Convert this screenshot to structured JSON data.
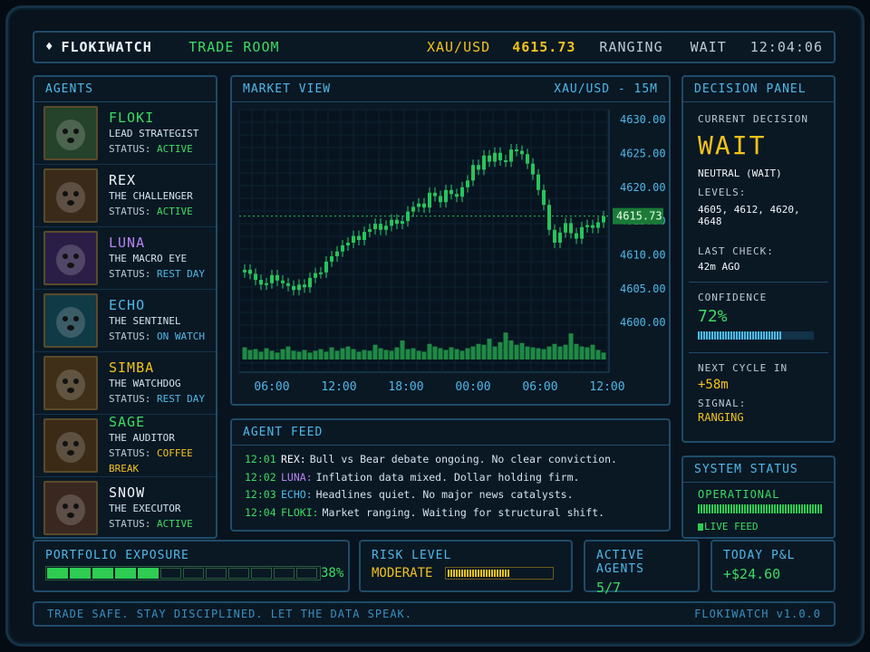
{
  "header": {
    "app": "FLOKIWATCH",
    "room": "TRADE ROOM",
    "symbol": "XAU/USD",
    "price": "4615.73",
    "state": "RANGING",
    "action": "WAIT",
    "clock": "12:04:06"
  },
  "agents": {
    "title": "AGENTS",
    "items": [
      {
        "name": "FLOKI",
        "role": "LEAD STRATEGIST",
        "status_label": "STATUS:",
        "status": "ACTIVE",
        "color": "#3ddc62",
        "status_color": "#3ddc62",
        "icon": "dog-avatar-icon",
        "bg": "#25422a"
      },
      {
        "name": "REX",
        "role": "THE CHALLENGER",
        "status_label": "STATUS:",
        "status": "ACTIVE",
        "color": "#eef6fb",
        "status_color": "#3ddc62",
        "icon": "dog-avatar-icon",
        "bg": "#3a2a1a"
      },
      {
        "name": "LUNA",
        "role": "THE MACRO EYE",
        "status_label": "STATUS:",
        "status": "REST DAY",
        "color": "#b784f0",
        "status_color": "#4fb8e8",
        "icon": "fox-avatar-icon",
        "bg": "#2a1e46"
      },
      {
        "name": "ECHO",
        "role": "THE SENTINEL",
        "status_label": "STATUS:",
        "status": "ON WATCH",
        "color": "#4fb8e8",
        "status_color": "#4fb8e8",
        "icon": "bat-avatar-icon",
        "bg": "#0f3a46"
      },
      {
        "name": "SIMBA",
        "role": "THE WATCHDOG",
        "status_label": "STATUS:",
        "status": "REST DAY",
        "color": "#f2c21b",
        "status_color": "#4fb8e8",
        "icon": "lion-avatar-icon",
        "bg": "#3f2f18"
      },
      {
        "name": "SAGE",
        "role": "THE AUDITOR",
        "status_label": "STATUS:",
        "status": "COFFEE BREAK",
        "color": "#3ddc62",
        "status_color": "#f2c21b",
        "icon": "owl-avatar-icon",
        "bg": "#3a2a16"
      },
      {
        "name": "SNOW",
        "role": "THE EXECUTOR",
        "status_label": "STATUS:",
        "status": "ACTIVE",
        "color": "#eef6fb",
        "status_color": "#3ddc62",
        "icon": "dog-avatar-icon",
        "bg": "#3a2820"
      }
    ]
  },
  "market": {
    "title": "MARKET VIEW",
    "pair": "XAU/USD - 15M"
  },
  "chart_data": {
    "type": "candlestick",
    "x_ticks": [
      "06:00",
      "12:00",
      "18:00",
      "00:00",
      "06:00",
      "12:00"
    ],
    "y_ticks": [
      "4630.00",
      "4625.00",
      "4620.00",
      "4615.00",
      "4610.00",
      "4605.00",
      "4600.00"
    ],
    "ylim": [
      4598,
      4631.5
    ],
    "last_price": "4615.73",
    "closes": [
      4607.8,
      4607.2,
      4606.3,
      4605.6,
      4605.8,
      4607.0,
      4606.2,
      4605.8,
      4605.4,
      4604.8,
      4605.6,
      4605.2,
      4606.6,
      4607.3,
      4607.4,
      4609.0,
      4609.8,
      4610.5,
      4611.4,
      4611.8,
      4612.8,
      4612.2,
      4613.4,
      4613.8,
      4614.6,
      4613.7,
      4614.3,
      4615.2,
      4614.6,
      4615.0,
      4616.4,
      4617.1,
      4617.6,
      4617.0,
      4619.2,
      4618.7,
      4617.8,
      4619.6,
      4619.0,
      4618.6,
      4620.0,
      4621.0,
      4623.3,
      4622.6,
      4624.7,
      4623.8,
      4625.1,
      4624.0,
      4623.8,
      4625.6,
      4625.4,
      4624.9,
      4623.5,
      4621.9,
      4619.6,
      4617.4,
      4613.7,
      4611.8,
      4613.3,
      4614.7,
      4613.2,
      4612.4,
      4614.1,
      4614.4,
      4614.0,
      4614.8,
      4615.7
    ],
    "volumes": [
      0.28,
      0.22,
      0.24,
      0.18,
      0.26,
      0.2,
      0.16,
      0.24,
      0.3,
      0.2,
      0.18,
      0.22,
      0.16,
      0.2,
      0.24,
      0.18,
      0.28,
      0.2,
      0.26,
      0.3,
      0.24,
      0.18,
      0.22,
      0.2,
      0.34,
      0.26,
      0.22,
      0.2,
      0.28,
      0.44,
      0.24,
      0.26,
      0.2,
      0.18,
      0.36,
      0.3,
      0.26,
      0.22,
      0.28,
      0.24,
      0.2,
      0.26,
      0.3,
      0.36,
      0.34,
      0.48,
      0.3,
      0.4,
      0.62,
      0.44,
      0.34,
      0.38,
      0.3,
      0.28,
      0.26,
      0.24,
      0.3,
      0.36,
      0.3,
      0.34,
      0.6,
      0.36,
      0.3,
      0.28,
      0.34,
      0.22,
      0.16
    ]
  },
  "feed": {
    "title": "AGENT FEED",
    "rows": [
      {
        "time": "12:01",
        "who": "REX:",
        "color": "#eef6fb",
        "msg": "Bull vs Bear debate ongoing. No clear conviction."
      },
      {
        "time": "12:02",
        "who": "LUNA:",
        "color": "#b784f0",
        "msg": "Inflation data mixed. Dollar holding firm."
      },
      {
        "time": "12:03",
        "who": "ECHO:",
        "color": "#4fb8e8",
        "msg": "Headlines quiet. No major news catalysts."
      },
      {
        "time": "12:04",
        "who": "FLOKI:",
        "color": "#3ddc62",
        "msg": "Market ranging. Waiting for structural shift."
      }
    ]
  },
  "decision": {
    "title": "DECISION PANEL",
    "current_label": "CURRENT DECISION",
    "current": "WAIT",
    "bias": "NEUTRAL (WAIT)",
    "levels_label": "LEVELS:",
    "levels": "4605, 4612, 4620, 4648",
    "last_check_label": "LAST CHECK:",
    "last_check": "42m AGO",
    "confidence_label": "CONFIDENCE",
    "confidence": "72%",
    "confidence_value": 0.72,
    "next_label": "NEXT CYCLE IN",
    "next": "+58m",
    "signal_label": "SIGNAL:",
    "signal": "RANGING"
  },
  "system": {
    "title": "SYSTEM STATUS",
    "state": "OPERATIONAL",
    "live": "LIVE FEED"
  },
  "portfolio": {
    "label": "PORTFOLIO EXPOSURE",
    "value": "38%",
    "fraction": 0.38
  },
  "risk": {
    "label": "RISK LEVEL",
    "value": "MODERATE"
  },
  "active": {
    "label": "ACTIVE AGENTS",
    "value": "5/7"
  },
  "pnl": {
    "label": "TODAY P&L",
    "value": "+$24.60"
  },
  "footer": {
    "motto": "TRADE SAFE. STAY DISCIPLINED. LET THE DATA SPEAK.",
    "version": "FLOKIWATCH v1.0.0"
  }
}
